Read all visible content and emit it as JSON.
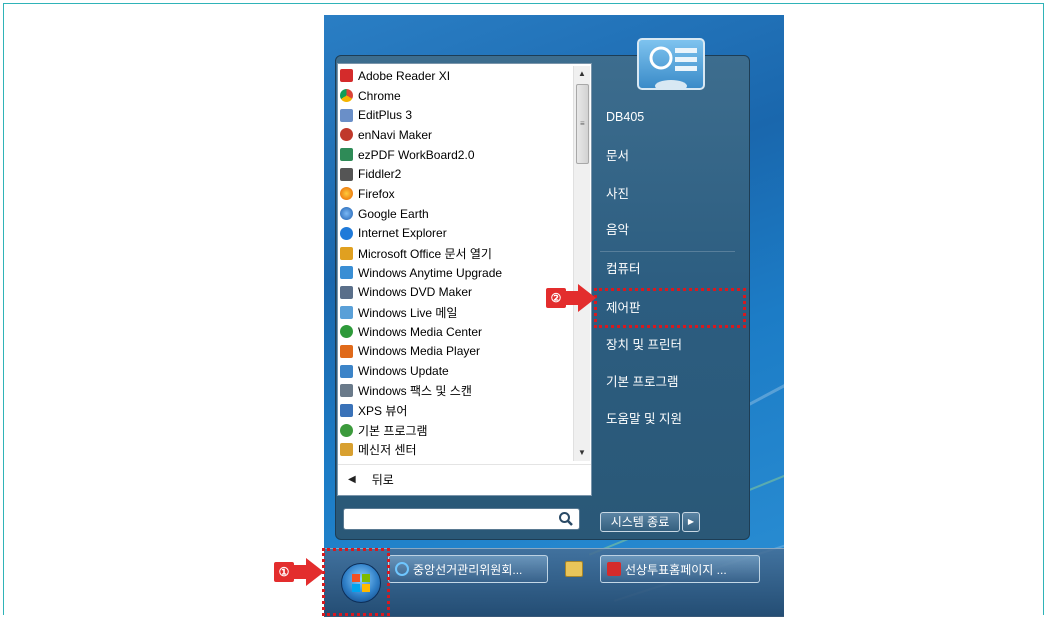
{
  "programs": [
    {
      "label": "Adobe Reader XI",
      "icon": "adobe-reader-icon",
      "color": "#d42b2b"
    },
    {
      "label": "Chrome",
      "icon": "chrome-icon",
      "color": "#4285f4"
    },
    {
      "label": "EditPlus 3",
      "icon": "editplus-icon",
      "color": "#6a8fc8"
    },
    {
      "label": "enNavi Maker",
      "icon": "ennavi-icon",
      "color": "#c0392b"
    },
    {
      "label": "ezPDF WorkBoard2.0",
      "icon": "ezpdf-icon",
      "color": "#2e8b57"
    },
    {
      "label": "Fiddler2",
      "icon": "fiddler-icon",
      "color": "#555555"
    },
    {
      "label": "Firefox",
      "icon": "firefox-icon",
      "color": "#e66000"
    },
    {
      "label": "Google Earth",
      "icon": "google-earth-icon",
      "color": "#2a6fd1"
    },
    {
      "label": "Internet Explorer",
      "icon": "internet-explorer-icon",
      "color": "#1f7ad9"
    },
    {
      "label": "Microsoft Office 문서 열기",
      "icon": "office-open-icon",
      "color": "#e0a020"
    },
    {
      "label": "Windows Anytime Upgrade",
      "icon": "windows-upgrade-icon",
      "color": "#3a8ed4"
    },
    {
      "label": "Windows DVD Maker",
      "icon": "dvd-maker-icon",
      "color": "#5a6f8a"
    },
    {
      "label": "Windows Live 메일",
      "icon": "live-mail-icon",
      "color": "#5aa0d8"
    },
    {
      "label": "Windows Media Center",
      "icon": "media-center-icon",
      "color": "#2e9a3a"
    },
    {
      "label": "Windows Media Player",
      "icon": "media-player-icon",
      "color": "#e06a1a"
    },
    {
      "label": "Windows Update",
      "icon": "windows-update-icon",
      "color": "#3c84c8"
    },
    {
      "label": "Windows 팩스 및 스캔",
      "icon": "fax-scan-icon",
      "color": "#6a7a8a"
    },
    {
      "label": "XPS 뷰어",
      "icon": "xps-viewer-icon",
      "color": "#3a72b8"
    },
    {
      "label": "기본 프로그램",
      "icon": "default-programs-icon",
      "color": "#3c9a3c"
    },
    {
      "label": "메신저 센터",
      "icon": "messenger-center-icon",
      "color": "#d8a030"
    }
  ],
  "back_label": "뒤로",
  "search_placeholder": "",
  "right_menu": {
    "user": "DB405",
    "documents": "문서",
    "pictures": "사진",
    "music": "음악",
    "computer": "컴퓨터",
    "control_panel": "제어판",
    "devices_printers": "장치 및 프린터",
    "default_programs": "기본 프로그램",
    "help_support": "도움말 및 지원"
  },
  "shutdown_label": "시스템 종료",
  "taskbar": {
    "item1": "중앙선거관리위원회...",
    "item2": "선상투표홈페이지 ..."
  },
  "callouts": {
    "step1": "①",
    "step2": "②"
  },
  "colors": {
    "highlight": "#d7191f",
    "callout": "#e32d2d"
  }
}
